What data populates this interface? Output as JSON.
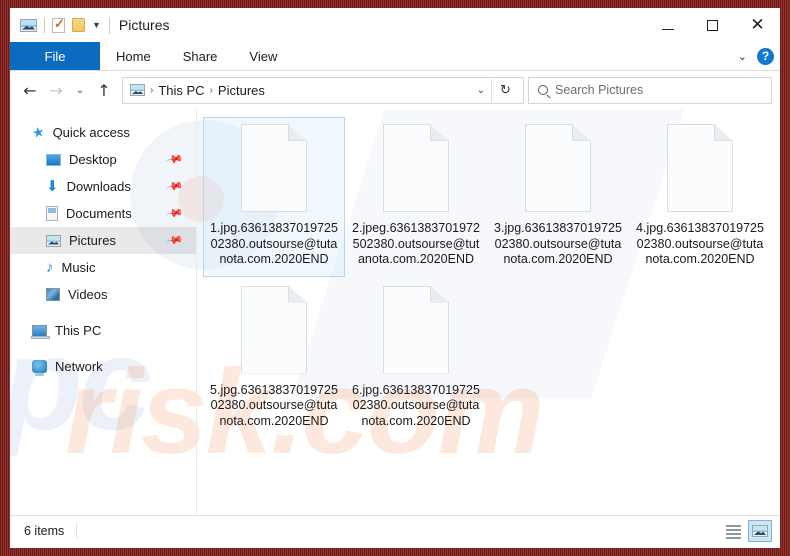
{
  "window": {
    "title": "Pictures",
    "quick_access_toolbar": [
      {
        "name": "pictures-icon",
        "label": "Pictures"
      },
      {
        "name": "properties-icon",
        "label": "Properties"
      },
      {
        "name": "new-folder-icon",
        "label": "New folder"
      },
      {
        "name": "customize-chevron-icon",
        "label": "▾"
      }
    ],
    "controls": {
      "minimize": "–",
      "maximize": "□",
      "close": "✕"
    }
  },
  "ribbon": {
    "tabs": [
      {
        "label": "File",
        "active": true
      },
      {
        "label": "Home",
        "active": false
      },
      {
        "label": "Share",
        "active": false
      },
      {
        "label": "View",
        "active": false
      }
    ],
    "expand_chevron": "⌄",
    "help_label": "?"
  },
  "address_bar": {
    "back": "←",
    "forward": "→",
    "recent": "⌄",
    "up": "↑",
    "crumbs": [
      "This PC",
      "Pictures"
    ],
    "separator": "›",
    "dropdown": "⌄",
    "refresh": "↻"
  },
  "search": {
    "placeholder": "Search Pictures",
    "icon": "search-icon"
  },
  "sidebar": {
    "items": [
      {
        "label": "Quick access",
        "icon": "star-icon",
        "child": false,
        "pinned": false,
        "selected": false
      },
      {
        "label": "Desktop",
        "icon": "desktop-icon",
        "child": true,
        "pinned": true,
        "selected": false
      },
      {
        "label": "Downloads",
        "icon": "download-icon",
        "child": true,
        "pinned": true,
        "selected": false
      },
      {
        "label": "Documents",
        "icon": "documents-icon",
        "child": true,
        "pinned": true,
        "selected": false
      },
      {
        "label": "Pictures",
        "icon": "pictures-icon",
        "child": true,
        "pinned": true,
        "selected": true
      },
      {
        "label": "Music",
        "icon": "music-icon",
        "child": true,
        "pinned": false,
        "selected": false
      },
      {
        "label": "Videos",
        "icon": "videos-icon",
        "child": true,
        "pinned": false,
        "selected": false
      },
      {
        "label": "This PC",
        "icon": "this-pc-icon",
        "child": false,
        "pinned": false,
        "selected": false
      },
      {
        "label": "Network",
        "icon": "network-icon",
        "child": false,
        "pinned": false,
        "selected": false
      }
    ],
    "pin_glyph": "📌"
  },
  "files": [
    {
      "name": "1.jpg.6361383701972502380.outsourse@tutanota.com.2020END",
      "selected": true
    },
    {
      "name": "2.jpeg.6361383701972502380.outsourse@tutanota.com.2020END",
      "selected": false
    },
    {
      "name": "3.jpg.6361383701972502380.outsourse@tutanota.com.2020END",
      "selected": false
    },
    {
      "name": "4.jpg.6361383701972502380.outsourse@tutanota.com.2020END",
      "selected": false
    },
    {
      "name": "5.jpg.6361383701972502380.outsourse@tutanota.com.2020END",
      "selected": false
    },
    {
      "name": "6.jpg.6361383701972502380.outsourse@tutanota.com.2020END",
      "selected": false
    }
  ],
  "status_bar": {
    "item_count": "6 items",
    "views": [
      {
        "name": "details-view",
        "active": false
      },
      {
        "name": "large-icons-view",
        "active": true
      }
    ]
  },
  "watermark": {
    "part1": "pc",
    "part2": "risk.com"
  },
  "colors": {
    "accent": "#0b6cbf",
    "help_blue": "#1177d1",
    "selection_border": "#b6d7ef",
    "frame": "#7b1d1d"
  }
}
